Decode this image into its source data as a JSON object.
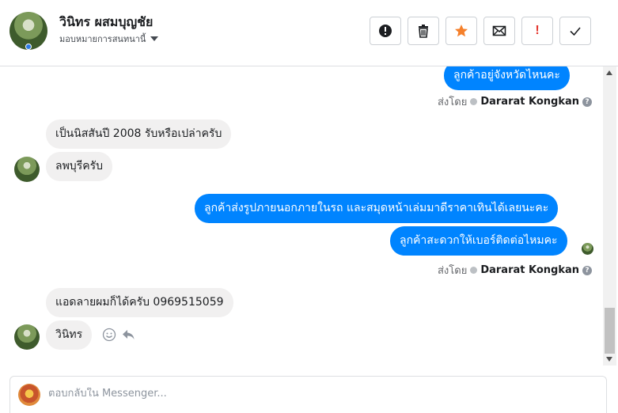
{
  "header": {
    "contact_name": "วินิทร ผสมบุญชัย",
    "assign_label": "มอบหมายการสนทนานี้",
    "actions": [
      {
        "name": "spam-button",
        "icon": "alert-circle-icon"
      },
      {
        "name": "delete-button",
        "icon": "trash-icon"
      },
      {
        "name": "star-button",
        "icon": "star-icon"
      },
      {
        "name": "mark-unread-button",
        "icon": "envelope-icon"
      },
      {
        "name": "important-button",
        "icon": "exclamation-icon",
        "label": "!"
      },
      {
        "name": "done-button",
        "icon": "check-icon"
      }
    ]
  },
  "conversation": {
    "messages": [
      {
        "from": "page",
        "text": "ลูกค้าอยู่จังหวัดไหนคะ"
      },
      {
        "from": "customer",
        "text": "เป็นนิสสันปี 2008 รับหรือเปล่าครับ"
      },
      {
        "from": "customer",
        "text": "ลพบุรีครับ"
      },
      {
        "from": "page",
        "text": "ลูกค้าส่งรูปภายนอกภายในรถ และสมุดหน้าเล่มมาดีราคาเทินได้เลยนะคะ"
      },
      {
        "from": "page",
        "text": "ลูกค้าสะดวกให้เบอร์ติดต่อไหมคะ"
      },
      {
        "from": "customer",
        "text": "แอดลายผมก็ได้ครับ 0969515059"
      },
      {
        "from": "customer",
        "text": "วินิทร"
      }
    ],
    "sent_by_label": "ส่งโดย",
    "agent_name": "Dararat Kongkan",
    "help_glyph": "?"
  },
  "reply": {
    "placeholder": "ตอบกลับใน Messenger..."
  },
  "colors": {
    "outgoing_bubble": "#0084ff",
    "incoming_bubble": "#f1f0f0",
    "star": "#f5802b",
    "important": "#e4372f"
  }
}
